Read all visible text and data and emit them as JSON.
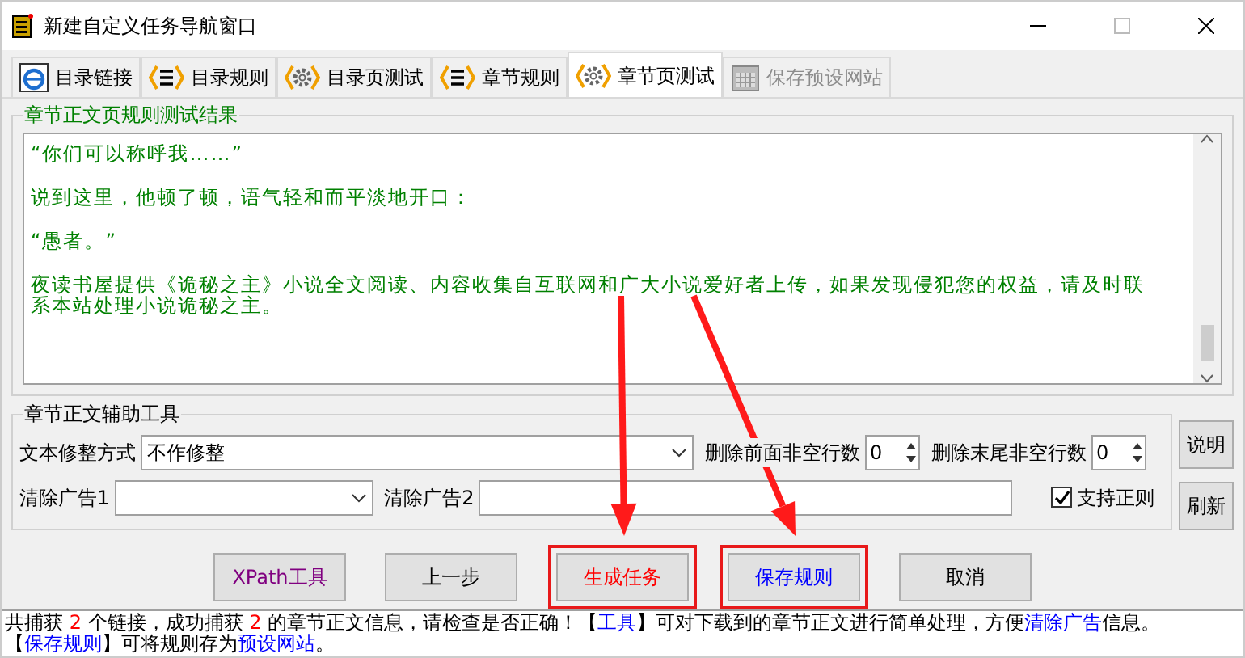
{
  "window": {
    "title": "新建自定义任务导航窗口"
  },
  "tabs": [
    {
      "label": "目录链接",
      "kind": "browser",
      "selected": false,
      "disabled": false
    },
    {
      "label": "目录规则",
      "kind": "rules",
      "selected": false,
      "disabled": false
    },
    {
      "label": "目录页测试",
      "kind": "test",
      "selected": false,
      "disabled": false
    },
    {
      "label": "章节规则",
      "kind": "rules",
      "selected": false,
      "disabled": false
    },
    {
      "label": "章节页测试",
      "kind": "test",
      "selected": true,
      "disabled": false
    },
    {
      "label": "保存预设网站",
      "kind": "save",
      "selected": false,
      "disabled": true
    }
  ],
  "result_group": {
    "title": "章节正文页规则测试结果",
    "paragraphs": [
      "“你们可以称呼我……”",
      "说到这里，他顿了顿，语气轻和而平淡地开口：",
      "“愚者。”",
      "夜读书屋提供《诡秘之主》小说全文阅读、内容收集自互联网和广大小说爱好者上传，如果发现侵犯您的权益，请及时联系本站处理小说诡秘之主。"
    ]
  },
  "tool_group": {
    "title": "章节正文辅助工具",
    "trim_label": "文本修整方式",
    "trim_value": "不作修整",
    "del_head_label": "删除前面非空行数",
    "del_head_value": "0",
    "del_tail_label": "删除末尾非空行数",
    "del_tail_value": "0",
    "ad1_label": "清除广告1",
    "ad2_label": "清除广告2",
    "regex_label": "支持正则",
    "regex_checked": true,
    "help_button": "说明",
    "refresh_button": "刷新"
  },
  "buttons": [
    {
      "label": "XPath工具",
      "color": "#800080",
      "highlighted": false,
      "arrow": false
    },
    {
      "label": "上一步",
      "color": "#000000",
      "highlighted": false,
      "arrow": false
    },
    {
      "label": "生成任务",
      "color": "#ff0000",
      "highlighted": true,
      "arrow": true
    },
    {
      "label": "保存规则",
      "color": "#0000ff",
      "highlighted": true,
      "arrow": true
    },
    {
      "label": "取消",
      "color": "#000000",
      "highlighted": false,
      "arrow": false
    }
  ],
  "status_bar": [
    {
      "kind": "plain",
      "text": "共捕获 "
    },
    {
      "kind": "number",
      "text": "2"
    },
    {
      "kind": "plain",
      "text": " 个链接，成功捕获 "
    },
    {
      "kind": "number",
      "text": "2"
    },
    {
      "kind": "plain",
      "text": " 的章节正文信息，请检查是否正确！【"
    },
    {
      "kind": "link",
      "text": "工具"
    },
    {
      "kind": "plain",
      "text": "】可对下载到的章节正文进行简单处理，方便"
    },
    {
      "kind": "link",
      "text": "清除广告"
    },
    {
      "kind": "plain",
      "text": "信息。【"
    },
    {
      "kind": "link",
      "text": "保存规则"
    },
    {
      "kind": "plain",
      "text": "】可将规则存为"
    },
    {
      "kind": "link",
      "text": "预设网站"
    },
    {
      "kind": "plain",
      "text": "。"
    }
  ]
}
